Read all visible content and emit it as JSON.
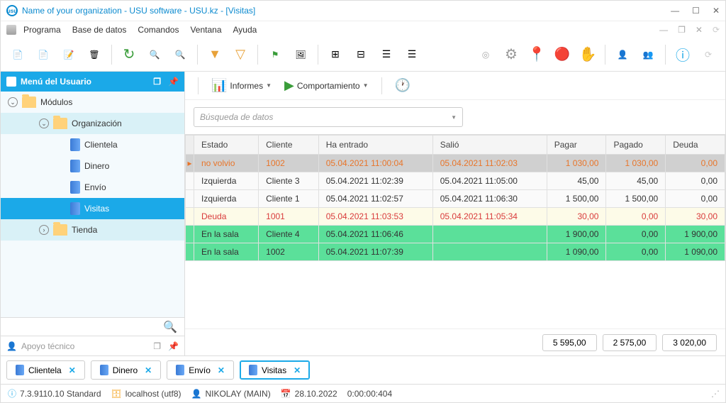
{
  "window": {
    "title": "Name of your organization - USU software - USU.kz - [Visitas]"
  },
  "menu": {
    "items": [
      "Programa",
      "Base de datos",
      "Comandos",
      "Ventana",
      "Ayuda"
    ]
  },
  "sidebar": {
    "title": "Menú del Usuario",
    "modules": "Módulos",
    "organization": "Organización",
    "items": [
      "Clientela",
      "Dinero",
      "Envío",
      "Visitas"
    ],
    "store": "Tienda",
    "support": "Apoyo técnico"
  },
  "actionbar": {
    "reports": "Informes",
    "behavior": "Comportamiento"
  },
  "search": {
    "placeholder": "Búsqueda de datos"
  },
  "table": {
    "headers": [
      "Estado",
      "Cliente",
      "Ha entrado",
      "Salió",
      "Pagar",
      "Pagado",
      "Deuda"
    ],
    "rows": [
      {
        "style": "row-selected",
        "estado": "no volvio",
        "cliente": "1002",
        "entrado": "05.04.2021 11:00:04",
        "salio": "05.04.2021 11:02:03",
        "pagar": "1 030,00",
        "pagado": "1 030,00",
        "deuda": "0,00"
      },
      {
        "style": "row-normal",
        "estado": "Izquierda",
        "cliente": "Cliente 3",
        "entrado": "05.04.2021 11:02:39",
        "salio": "05.04.2021 11:05:00",
        "pagar": "45,00",
        "pagado": "45,00",
        "deuda": "0,00"
      },
      {
        "style": "row-normal",
        "estado": "Izquierda",
        "cliente": "Cliente 1",
        "entrado": "05.04.2021 11:02:57",
        "salio": "05.04.2021 11:06:30",
        "pagar": "1 500,00",
        "pagado": "1 500,00",
        "deuda": "0,00"
      },
      {
        "style": "row-debt",
        "estado": "Deuda",
        "cliente": "1001",
        "entrado": "05.04.2021 11:03:53",
        "salio": "05.04.2021 11:05:34",
        "pagar": "30,00",
        "pagado": "0,00",
        "deuda": "30,00"
      },
      {
        "style": "row-green",
        "estado": "En la sala",
        "cliente": "Cliente 4",
        "entrado": "05.04.2021 11:06:46",
        "salio": "",
        "pagar": "1 900,00",
        "pagado": "0,00",
        "deuda": "1 900,00"
      },
      {
        "style": "row-green",
        "estado": "En la sala",
        "cliente": "1002",
        "entrado": "05.04.2021 11:07:39",
        "salio": "",
        "pagar": "1 090,00",
        "pagado": "0,00",
        "deuda": "1 090,00"
      }
    ]
  },
  "totals": {
    "pagar": "5 595,00",
    "pagado": "2 575,00",
    "deuda": "3 020,00"
  },
  "tabs": {
    "items": [
      "Clientela",
      "Dinero",
      "Envío",
      "Visitas"
    ]
  },
  "status": {
    "version": "7.3.9110.10 Standard",
    "host": "localhost (utf8)",
    "user": "NIKOLAY (MAIN)",
    "date": "28.10.2022",
    "elapsed": "0:00:00:404"
  }
}
